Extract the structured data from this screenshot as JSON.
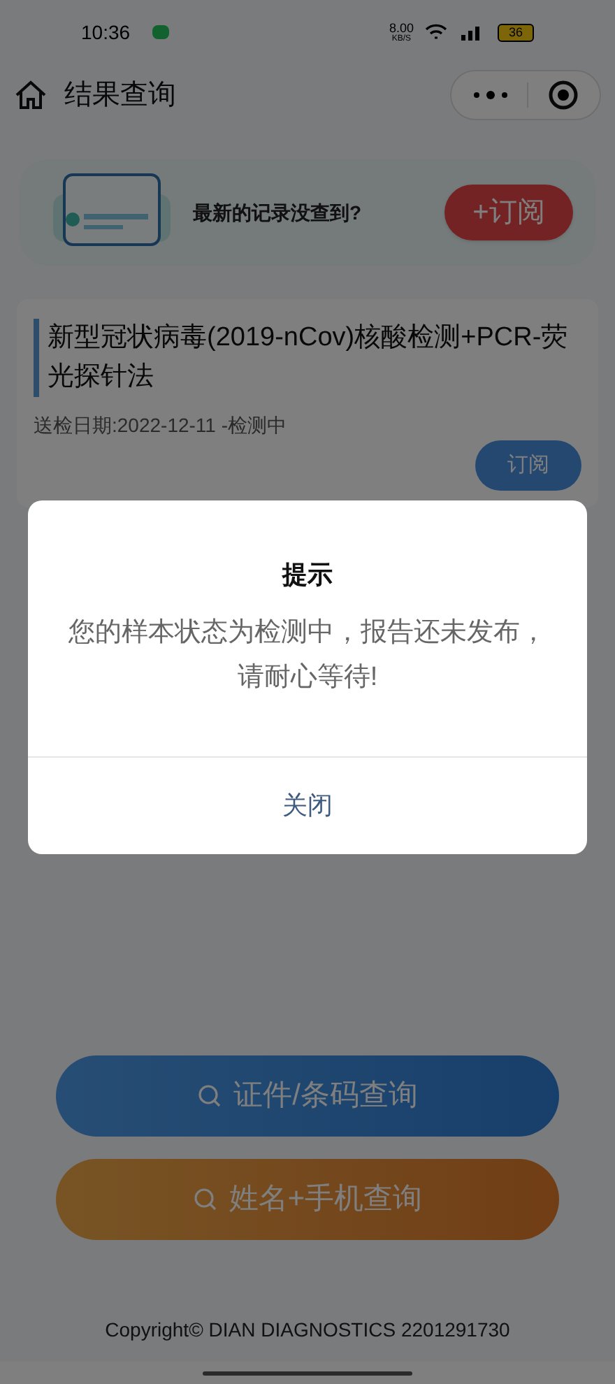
{
  "status_bar": {
    "time": "10:36",
    "speed": "8.00",
    "speed_unit": "KB/S",
    "battery": "36"
  },
  "nav": {
    "title": "结果查询"
  },
  "promo": {
    "text": "最新的记录没查到?",
    "button": "+订阅"
  },
  "records": [
    {
      "title": "新型冠状病毒(2019-nCov)核酸检测+PCR-荧光探针法",
      "info": "送检日期:2022-12-11 -检测中",
      "button": "订阅"
    }
  ],
  "dialog": {
    "title": "提示",
    "message": "您的样本状态为检测中，报告还未发布，请耐心等待!",
    "button": "关闭"
  },
  "buttons": [
    {
      "label": "证件/条码查询",
      "kind": "blue"
    },
    {
      "label": "姓名+手机查询",
      "kind": "orange"
    }
  ],
  "footer": "Copyright© DIAN DIAGNOSTICS 2201291730"
}
